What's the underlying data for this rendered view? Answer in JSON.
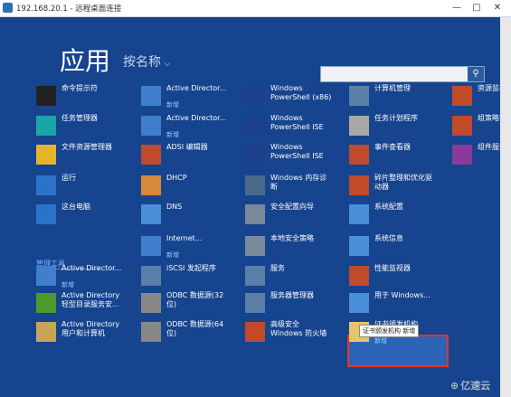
{
  "window": {
    "title": "192.168.20.1 - 远程桌面连接",
    "min": "—",
    "max": "□",
    "close": "✕"
  },
  "page": {
    "heading": "应用",
    "sort_label": "按名称",
    "sort_icon": "⌵",
    "search_icon": "⚲"
  },
  "group_label": "管理工具",
  "tooltip": "证书颁发机构 新增",
  "watermark": "亿速云",
  "columns": [
    [
      {
        "label": "命令提示符",
        "icon": "cmd-icon",
        "color": "#222222"
      },
      {
        "label": "任务管理器",
        "icon": "taskmgr-icon",
        "color": "#1aa6a6"
      },
      {
        "label": "文件资源管理器",
        "icon": "folder-icon",
        "color": "#e5b42a"
      },
      {
        "label": "运行",
        "icon": "run-icon",
        "color": "#2b73c8"
      },
      {
        "label": "这台电脑",
        "icon": "computer-icon",
        "color": "#2b73c8"
      },
      {
        "label": "Active Director...",
        "badge": "新增",
        "icon": "ad-icon",
        "color": "#3f7fcb"
      },
      {
        "label": "Active Directory",
        "label2": "轻型目录服务安...",
        "icon": "adlds-icon",
        "color": "#4c9a2a"
      },
      {
        "label": "Active Directory",
        "label2": "用户和计算机",
        "icon": "aduc-icon",
        "color": "#c8a45a"
      }
    ],
    [
      {
        "label": "Active Director...",
        "badge": "新增",
        "icon": "ad-icon",
        "color": "#3f7fcb"
      },
      {
        "label": "Active Director...",
        "badge": "新增",
        "icon": "ad-icon",
        "color": "#3f7fcb"
      },
      {
        "label": "ADSI 编辑器",
        "icon": "adsi-icon",
        "color": "#c04a2a"
      },
      {
        "label": "DHCP",
        "icon": "dhcp-icon",
        "color": "#d88a3a"
      },
      {
        "label": "DNS",
        "icon": "dns-icon",
        "color": "#4a8fd8"
      },
      {
        "label": "Internet...",
        "badge": "新增",
        "icon": "iis-icon",
        "color": "#3f7fcb"
      },
      {
        "label": "iSCSI 发起程序",
        "icon": "iscsi-icon",
        "color": "#5a7fa8"
      },
      {
        "label": "ODBC 数据源(32",
        "label2": "位)",
        "icon": "odbc-icon",
        "color": "#888888"
      },
      {
        "label": "ODBC 数据源(64",
        "label2": "位)",
        "icon": "odbc-icon",
        "color": "#888888"
      }
    ],
    [
      {
        "label": "Windows",
        "label2": "PowerShell (x86)",
        "icon": "powershell-icon",
        "color": "#1b3f8a"
      },
      {
        "label": "Windows",
        "label2": "PowerShell ISE",
        "icon": "powershell-icon",
        "color": "#1b3f8a"
      },
      {
        "label": "Windows",
        "label2": "PowerShell ISE",
        "icon": "powershell-icon",
        "color": "#1b3f8a"
      },
      {
        "label": "Windows 内存诊",
        "label2": "断",
        "icon": "memory-icon",
        "color": "#4a6a8a"
      },
      {
        "label": "安全配置向导",
        "icon": "security-icon",
        "color": "#7a8a9a"
      },
      {
        "label": "本地安全策略",
        "icon": "policy-icon",
        "color": "#7a8a9a"
      },
      {
        "label": "服务",
        "icon": "services-icon",
        "color": "#5a7fa8"
      },
      {
        "label": "服务器管理器",
        "icon": "server-icon",
        "color": "#5a7fa8"
      },
      {
        "label": "高级安全",
        "label2": "Windows 防火墙",
        "icon": "firewall-icon",
        "color": "#c04a2a"
      }
    ],
    [
      {
        "label": "计算机管理",
        "icon": "compmgmt-icon",
        "color": "#5a7fa8"
      },
      {
        "label": "任务计划程序",
        "icon": "scheduler-icon",
        "color": "#a8a8a8"
      },
      {
        "label": "事件查看器",
        "icon": "eventvwr-icon",
        "color": "#c04a2a"
      },
      {
        "label": "碎片整理和优化驱",
        "label2": "动器",
        "icon": "defrag-icon",
        "color": "#c04a2a"
      },
      {
        "label": "系统配置",
        "icon": "msconfig-icon",
        "color": "#4a8fd8"
      },
      {
        "label": "系统信息",
        "icon": "msinfo-icon",
        "color": "#4a8fd8"
      },
      {
        "label": "性能监视器",
        "icon": "perfmon-icon",
        "color": "#c04a2a"
      },
      {
        "label": "用于 Windows...",
        "icon": "backup-icon",
        "color": "#4a8fd8"
      },
      {
        "label": "证书颁发机构",
        "badge": "新增",
        "icon": "certsrv-icon",
        "color": "#e8c46a"
      }
    ],
    [
      {
        "label": "资源监视",
        "icon": "resmon-icon",
        "color": "#c04a2a"
      },
      {
        "label": "组策略管",
        "icon": "gpmc-icon",
        "color": "#c04a2a"
      },
      {
        "label": "组件服务",
        "icon": "comsvcs-icon",
        "color": "#8a3a9a"
      }
    ]
  ]
}
